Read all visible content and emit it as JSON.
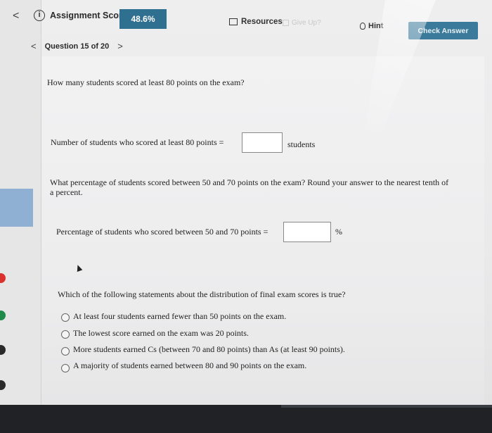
{
  "toolbar": {
    "back": "<",
    "info_icon": "i",
    "score_label": "Assignment Score:",
    "score_value": "48.6%",
    "resources": "Resources",
    "give_up": "Give Up?",
    "hint": "Hint",
    "check_answer": "Check Answer"
  },
  "question_nav": {
    "prev": "<",
    "label": "Question 15 of 20",
    "next": ">"
  },
  "question": {
    "prompt": "How many students scored at least 80 points on the exam?",
    "part1_label": "Number of students who scored at least 80 points =",
    "part1_value": "",
    "part1_unit": "students",
    "part2_prompt_line1": "What percentage of students scored between 50 and 70 points on the exam? Round your answer to the nearest tenth of",
    "part2_prompt_line2": "a percent.",
    "part2_label": "Percentage of students who scored between 50 and 70 points =",
    "part2_value": "",
    "part2_unit": "%",
    "part3_prompt": "Which of the following statements about the distribution of final exam scores is true?",
    "options": [
      "At least four students earned fewer than 50 points on the exam.",
      "The lowest score earned on the exam was 20 points.",
      "More students earned Cs (between 70 and 80 points) than As (at least 90 points).",
      "A majority of students earned between 80 and 90 points on the exam."
    ]
  },
  "colors": {
    "score_badge": "#2f6f8f",
    "check_answer": "#3b7a9a",
    "left_strip": "#8fb0d3"
  }
}
